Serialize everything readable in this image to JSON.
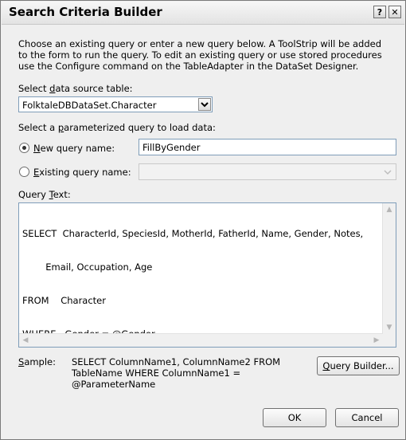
{
  "window": {
    "title": "Search Criteria Builder",
    "help_glyph": "?",
    "close_glyph": "✕"
  },
  "description": "Choose an existing query or enter a new query below. A ToolStrip will be added to the form to run the query. To edit an existing query or use stored procedures use the Configure command on the TableAdapter in the DataSet Designer.",
  "data_source": {
    "label_pre": "Select ",
    "label_key": "d",
    "label_post": "ata source table:",
    "selected": "FolktaleDBDataSet.Character"
  },
  "query_section": {
    "label_pre": "Select a ",
    "label_key": "p",
    "label_post": "arameterized query to load data:"
  },
  "new_query": {
    "label_key": "N",
    "label_post": "ew query name:",
    "selected": true,
    "value": "FillByGender"
  },
  "existing_query": {
    "label_key": "E",
    "label_post": "xisting query name:",
    "selected": false,
    "value": ""
  },
  "query_text": {
    "label_pre": "Query ",
    "label_key": "T",
    "label_post": "ext:",
    "lines": [
      "SELECT  CharacterId, SpeciesId, MotherId, FatherId, Name, Gender, Notes,",
      "        Email, Occupation, Age",
      "FROM    Character",
      "WHERE   Gender = @Gender"
    ]
  },
  "sample": {
    "label_key": "S",
    "label_post": "ample:",
    "lines": [
      "SELECT ColumnName1, ColumnName2 FROM",
      "TableName WHERE ColumnName1 =",
      "@ParameterName"
    ]
  },
  "buttons": {
    "query_builder_key": "Q",
    "query_builder_post": "uery Builder...",
    "ok": "OK",
    "cancel": "Cancel"
  },
  "icons": {
    "dropdown": "chevron-down-icon",
    "scroll_up": "▲",
    "scroll_down": "▼",
    "scroll_left": "◀",
    "scroll_right": "▶"
  },
  "colors": {
    "window_bg": "#efefef",
    "field_border": "#7f9db9"
  }
}
